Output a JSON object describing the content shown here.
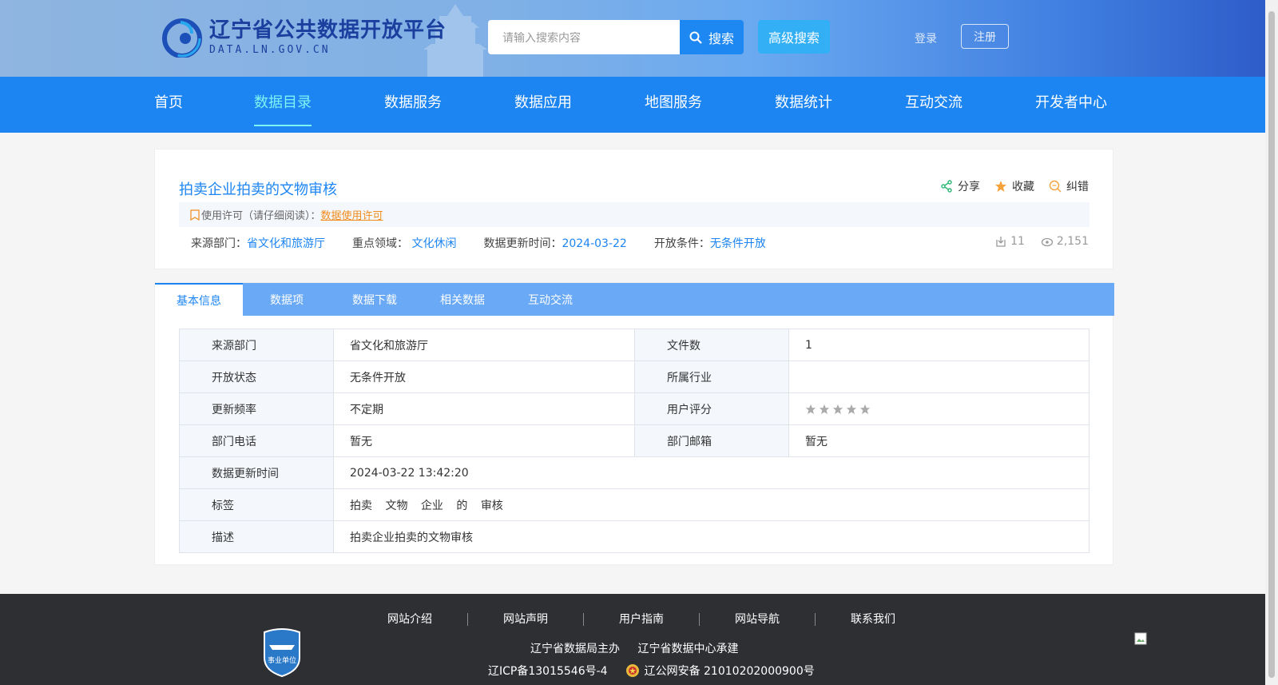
{
  "header": {
    "logo_title": "辽宁省公共数据开放平台",
    "logo_sub": "DATA.LN.GOV.CN",
    "search_placeholder": "请输入搜索内容",
    "search_label": "搜索",
    "advanced_search_label": "高级搜索",
    "login_label": "登录",
    "register_label": "注册"
  },
  "nav": [
    {
      "label": "首页"
    },
    {
      "label": "数据目录",
      "active": true
    },
    {
      "label": "数据服务"
    },
    {
      "label": "数据应用"
    },
    {
      "label": "地图服务"
    },
    {
      "label": "数据统计"
    },
    {
      "label": "互动交流"
    },
    {
      "label": "开发者中心"
    }
  ],
  "dataset": {
    "title": "拍卖企业拍卖的文物审核",
    "actions": {
      "share": "分享",
      "favorite": "收藏",
      "report": "纠错"
    },
    "license_label": "使用许可（请仔细阅读）：",
    "license_link": "数据使用许可",
    "meta": {
      "source_label": "来源部门：",
      "source_value": "省文化和旅游厅",
      "domain_label": "重点领域：",
      "domain_value": "文化休闲",
      "updated_label": "数据更新时间：",
      "updated_value": "2024-03-22",
      "open_label": "开放条件：",
      "open_value": "无条件开放"
    },
    "downloads": "11",
    "views": "2,151"
  },
  "tabs": [
    {
      "label": "基本信息",
      "active": true
    },
    {
      "label": "数据项"
    },
    {
      "label": "数据下载"
    },
    {
      "label": "相关数据"
    },
    {
      "label": "互动交流"
    }
  ],
  "info": {
    "source_dept_k": "来源部门",
    "source_dept_v": "省文化和旅游厅",
    "file_count_k": "文件数",
    "file_count_v": "1",
    "open_status_k": "开放状态",
    "open_status_v": "无条件开放",
    "industry_k": "所属行业",
    "industry_v": "",
    "frequency_k": "更新频率",
    "frequency_v": "不定期",
    "rating_k": "用户评分",
    "rating_value": 0,
    "rating_max": 5,
    "phone_k": "部门电话",
    "phone_v": "暂无",
    "email_k": "部门邮箱",
    "email_v": "暂无",
    "update_time_k": "数据更新时间",
    "update_time_v": "2024-03-22 13:42:20",
    "tags_k": "标签",
    "tags": [
      "拍卖",
      "文物",
      "企业",
      "的",
      "审核"
    ],
    "desc_k": "描述",
    "desc_v": "拍卖企业拍卖的文物审核"
  },
  "footer": {
    "links": [
      "网站介绍",
      "网站声明",
      "用户指南",
      "网站导航",
      "联系我们"
    ],
    "host": "辽宁省数据局主办",
    "operator": "辽宁省数据中心承建",
    "icp": "辽ICP备13015546号-4",
    "police": "辽公网安备 21010202000900号",
    "badge_text": "事业单位"
  },
  "colors": {
    "primary": "#1c85f1",
    "nav_active": "#7ef3f3",
    "license_link": "#f08c1e",
    "footer_bg": "#2d2f33"
  }
}
